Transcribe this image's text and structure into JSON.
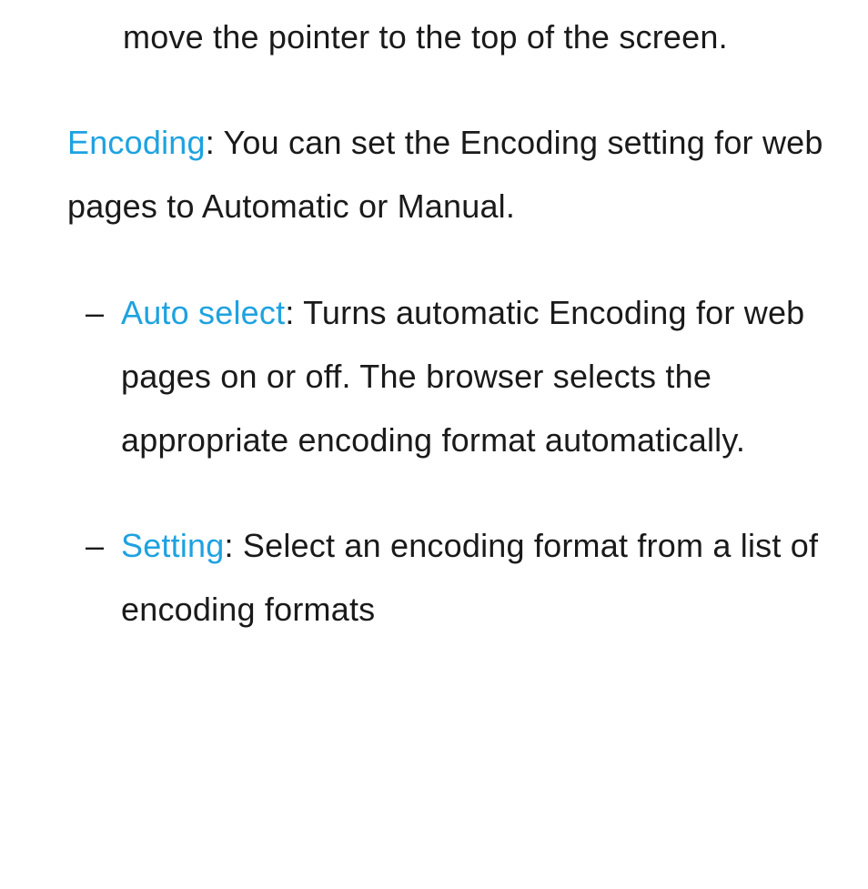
{
  "intro_fragment": "move the pointer to the top of the screen.",
  "encoding": {
    "term": "Encoding",
    "desc": ": You can set the Encoding setting for web pages to Automatic or Manual."
  },
  "auto_select": {
    "dash": "–",
    "term": "Auto select",
    "desc": ": Turns automatic Encoding for web pages on or off. The browser selects the appropriate encoding format automatically."
  },
  "setting": {
    "dash": "–",
    "term": "Setting",
    "desc": ": Select an encoding format from a list of encoding formats"
  }
}
